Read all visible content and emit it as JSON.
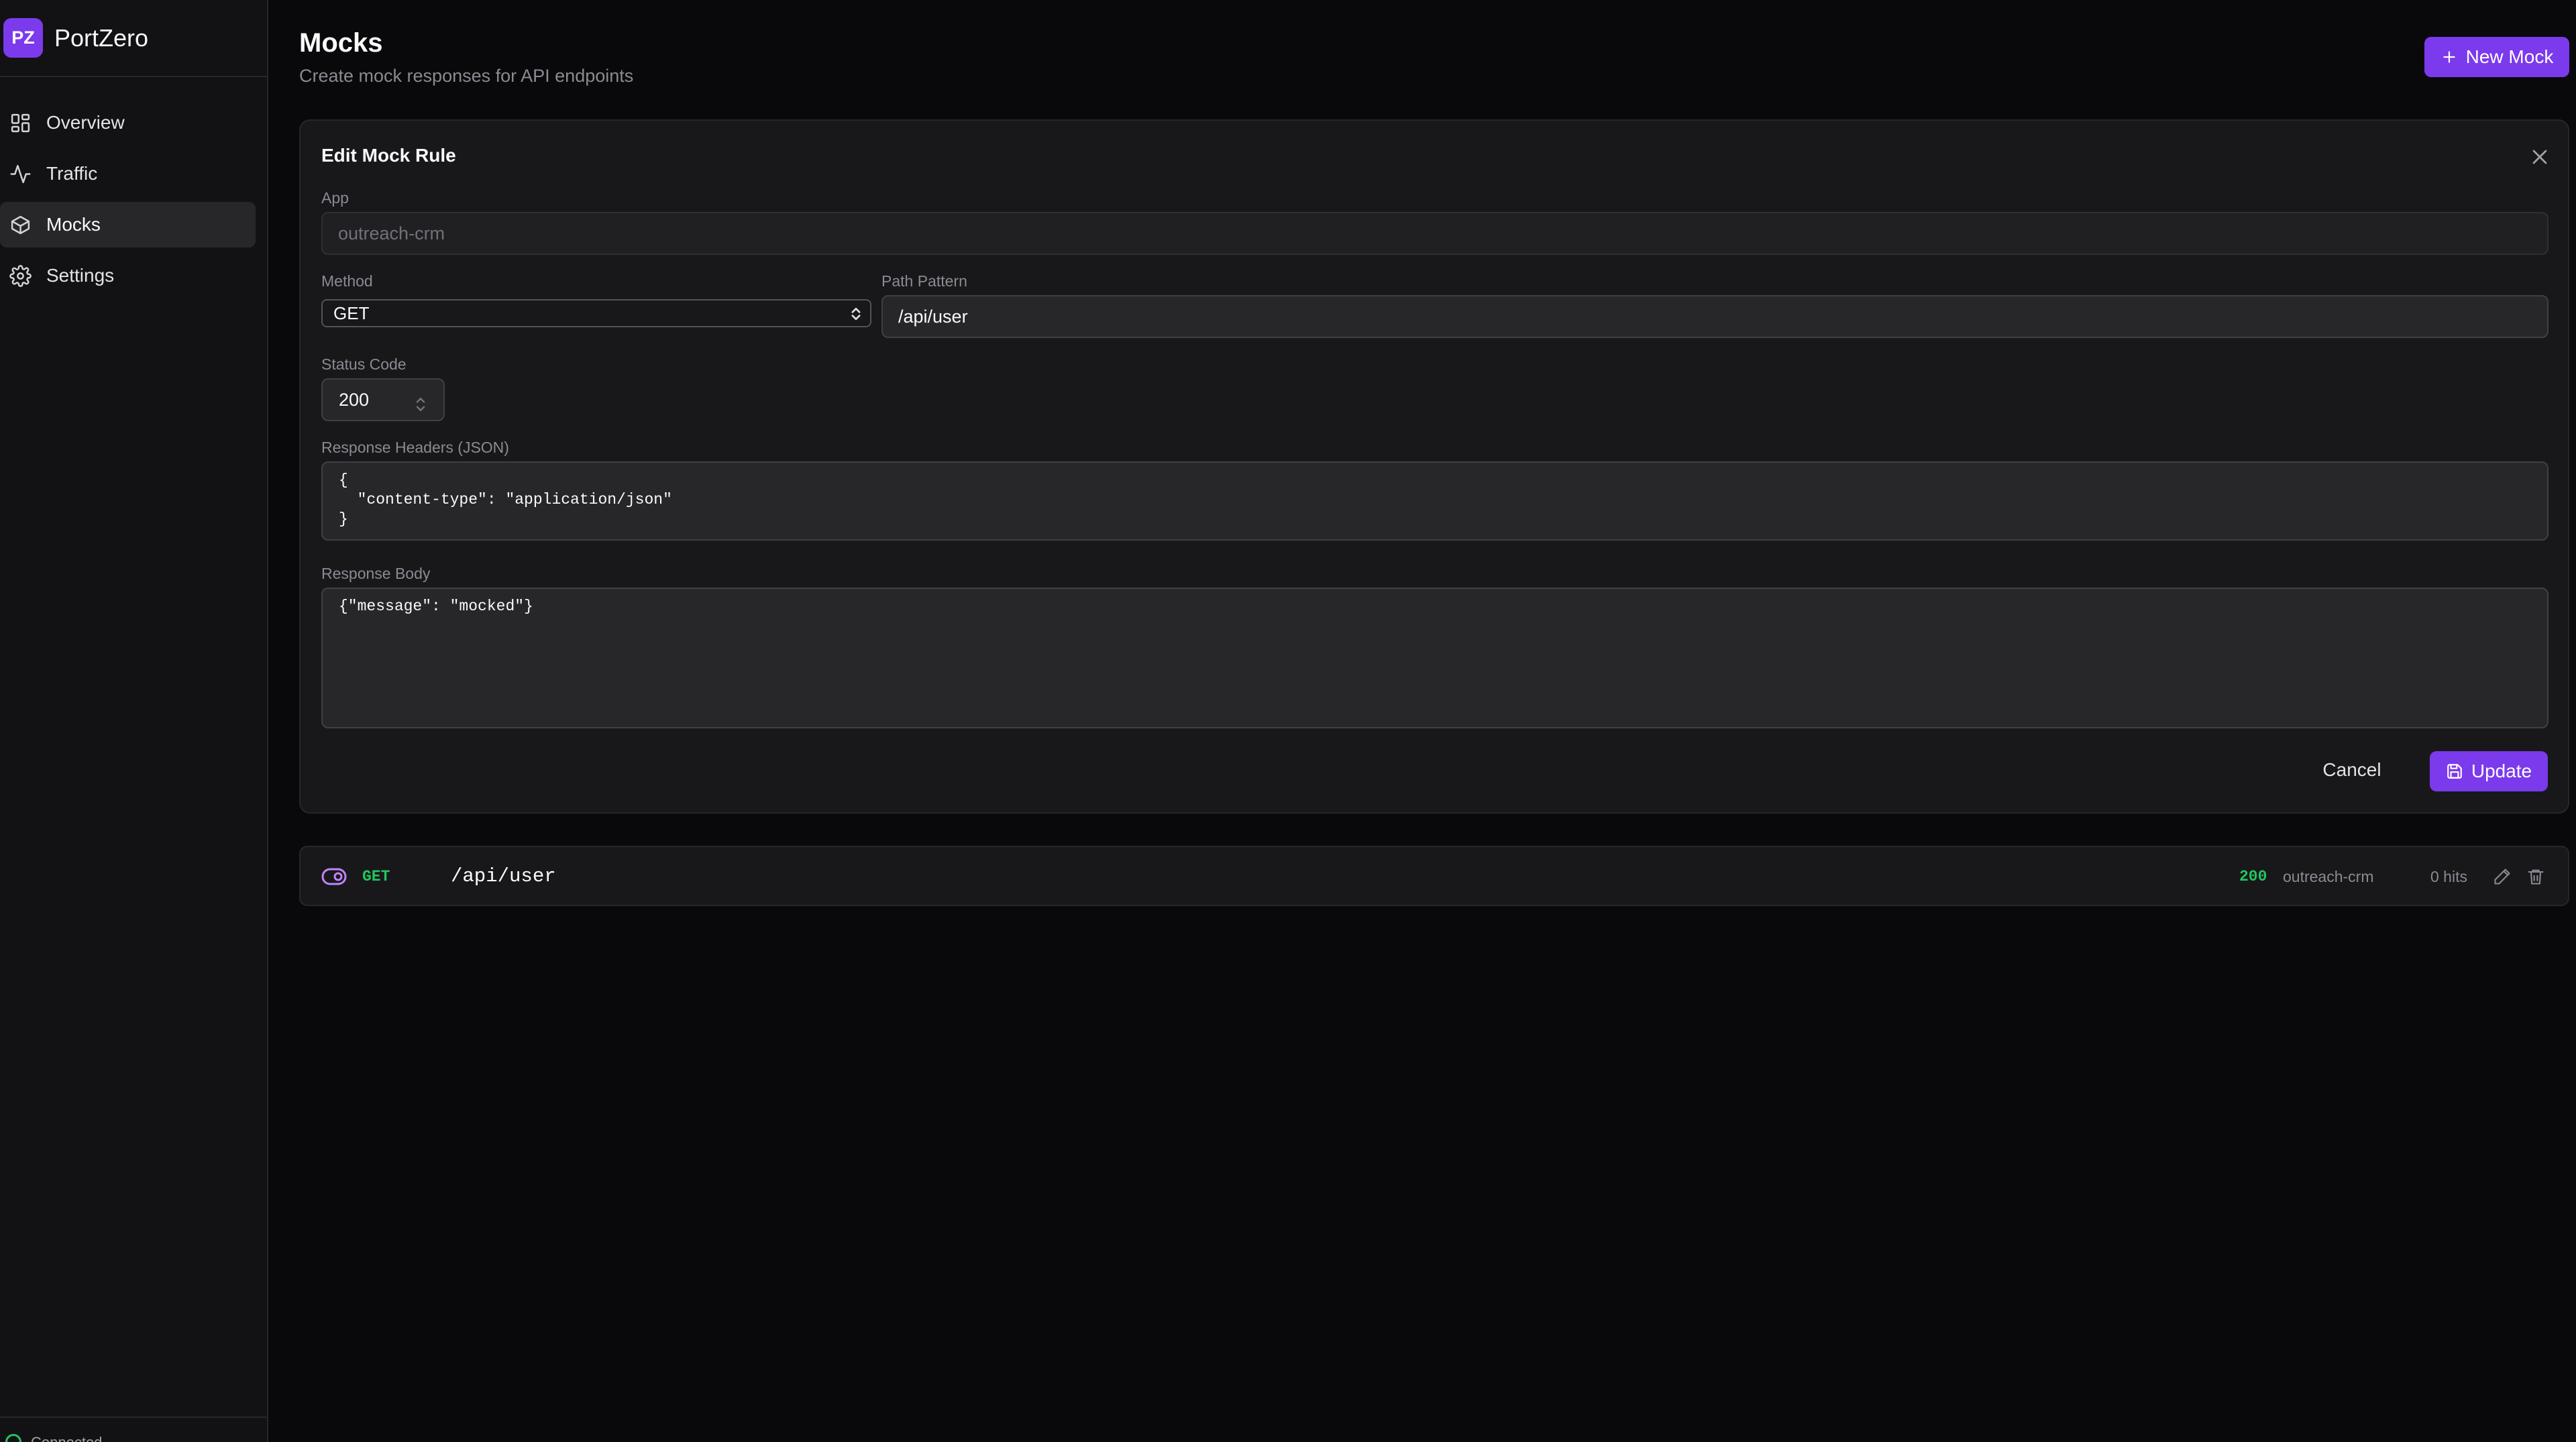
{
  "brand": {
    "logo_text": "PZ",
    "name": "PortZero",
    "accent": "#7c3aed"
  },
  "sidebar": {
    "items": [
      {
        "label": "Overview",
        "icon": "dashboard-icon",
        "active": false
      },
      {
        "label": "Traffic",
        "icon": "activity-icon",
        "active": false
      },
      {
        "label": "Mocks",
        "icon": "box-icon",
        "active": true
      },
      {
        "label": "Settings",
        "icon": "gear-icon",
        "active": false
      }
    ],
    "footer_status": "Connected"
  },
  "page": {
    "title": "Mocks",
    "subtitle": "Create mock responses for API endpoints",
    "new_button_label": "New Mock"
  },
  "edit_form": {
    "title": "Edit Mock Rule",
    "app_label": "App",
    "app_value": "outreach-crm",
    "method_label": "Method",
    "method_value": "GET",
    "path_label": "Path Pattern",
    "path_value": "/api/user",
    "status_label": "Status Code",
    "status_value": "200",
    "headers_label": "Response Headers (JSON)",
    "headers_value": "{\n  \"content-type\": \"application/json\"\n}",
    "body_label": "Response Body",
    "body_value": "{\"message\": \"mocked\"}",
    "cancel_label": "Cancel",
    "update_label": "Update"
  },
  "mocks": [
    {
      "enabled": true,
      "method": "GET",
      "path": "/api/user",
      "status": "200",
      "app": "outreach-crm",
      "hits": "0 hits"
    }
  ],
  "colors": {
    "background": "#09090b",
    "sidebar": "#121214",
    "card": "#18181b",
    "success": "#22c55e",
    "accent": "#7c3aed"
  }
}
